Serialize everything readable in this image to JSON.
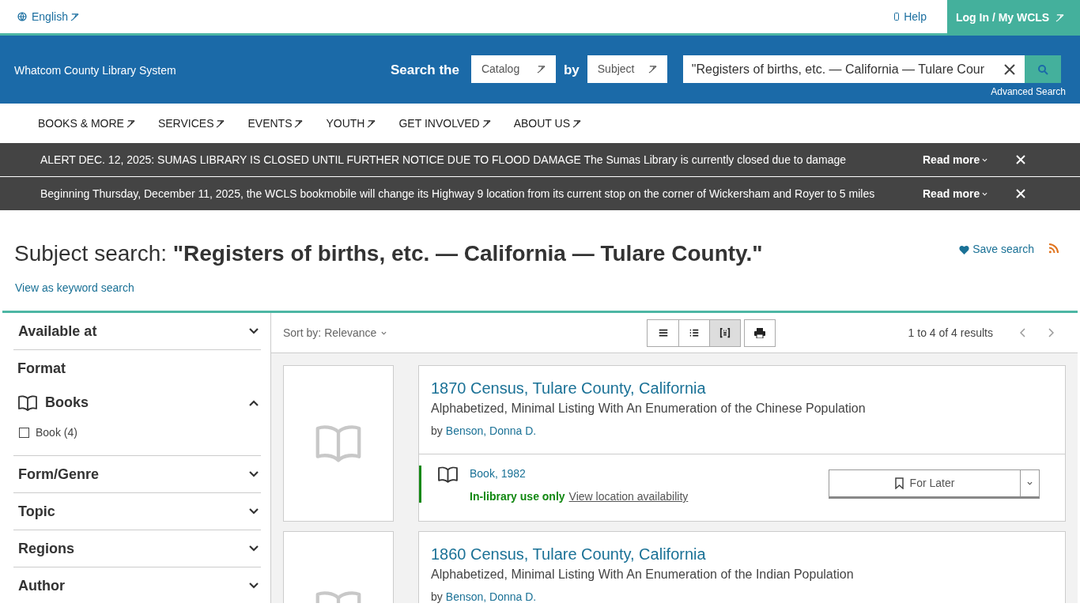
{
  "top_bar": {
    "language": "English",
    "help": "Help",
    "login": "Log In / My WCLS"
  },
  "header": {
    "logo_text": "Whatcom County Library System",
    "search_label": "Search the",
    "scope": "Catalog",
    "by": "by",
    "search_by": "Subject",
    "query": "\"Registers of births, etc. — California — Tulare Cour",
    "advanced": "Advanced Search"
  },
  "nav": [
    "BOOKS & MORE",
    "SERVICES",
    "EVENTS",
    "YOUTH",
    "GET INVOLVED",
    "ABOUT US"
  ],
  "alerts": [
    {
      "text": "ALERT DEC. 12, 2025: SUMAS LIBRARY IS CLOSED UNTIL FURTHER NOTICE DUE TO FLOOD DAMAGE The Sumas Library is currently closed due to damage",
      "read_more": "Read more"
    },
    {
      "text": "Beginning Thursday, December 11, 2025, the WCLS bookmobile will change its Highway 9 location from its current stop on the corner of Wickersham and Royer to 5 miles",
      "read_more": "Read more"
    }
  ],
  "page_heading": "Subject search: **\"Registers of births, etc. — California — Tulare County.\"**",
  "keyword_link": "View as keyword search",
  "save_search": "Save search",
  "sidebar": {
    "facets_before": [
      {
        "label": "Available at",
        "expanded": false
      }
    ],
    "format": {
      "heading": "Format",
      "group": {
        "label": "Books",
        "expanded": true,
        "options": [
          {
            "label": "Book (4)",
            "checked": false
          }
        ]
      }
    },
    "facets_after": [
      {
        "label": "Form/Genre",
        "expanded": false
      },
      {
        "label": "Topic",
        "expanded": false
      },
      {
        "label": "Regions",
        "expanded": false
      },
      {
        "label": "Author",
        "expanded": false
      }
    ]
  },
  "toolbar": {
    "sort": "Sort by: Relevance",
    "view_modes": [
      {
        "selected": false
      },
      {
        "selected": false
      },
      {
        "selected": true
      }
    ],
    "results_count": "1 to 4 of 4 results"
  },
  "results": [
    {
      "title": "1870 Census, Tulare County, California",
      "subtitle": "Alphabetized, Minimal Listing With An Enumeration of the Chinese Population",
      "by": "by",
      "author": "Benson, Donna D.",
      "format": "Book, 1982",
      "availability": "In-library use only",
      "location_link": "View location availability",
      "action": "For Later"
    },
    {
      "title": "1860 Census, Tulare County, California",
      "subtitle": "Alphabetized, Minimal Listing With An Enumeration of the Indian Population",
      "by": "by",
      "author": "Benson, Donna D."
    }
  ]
}
